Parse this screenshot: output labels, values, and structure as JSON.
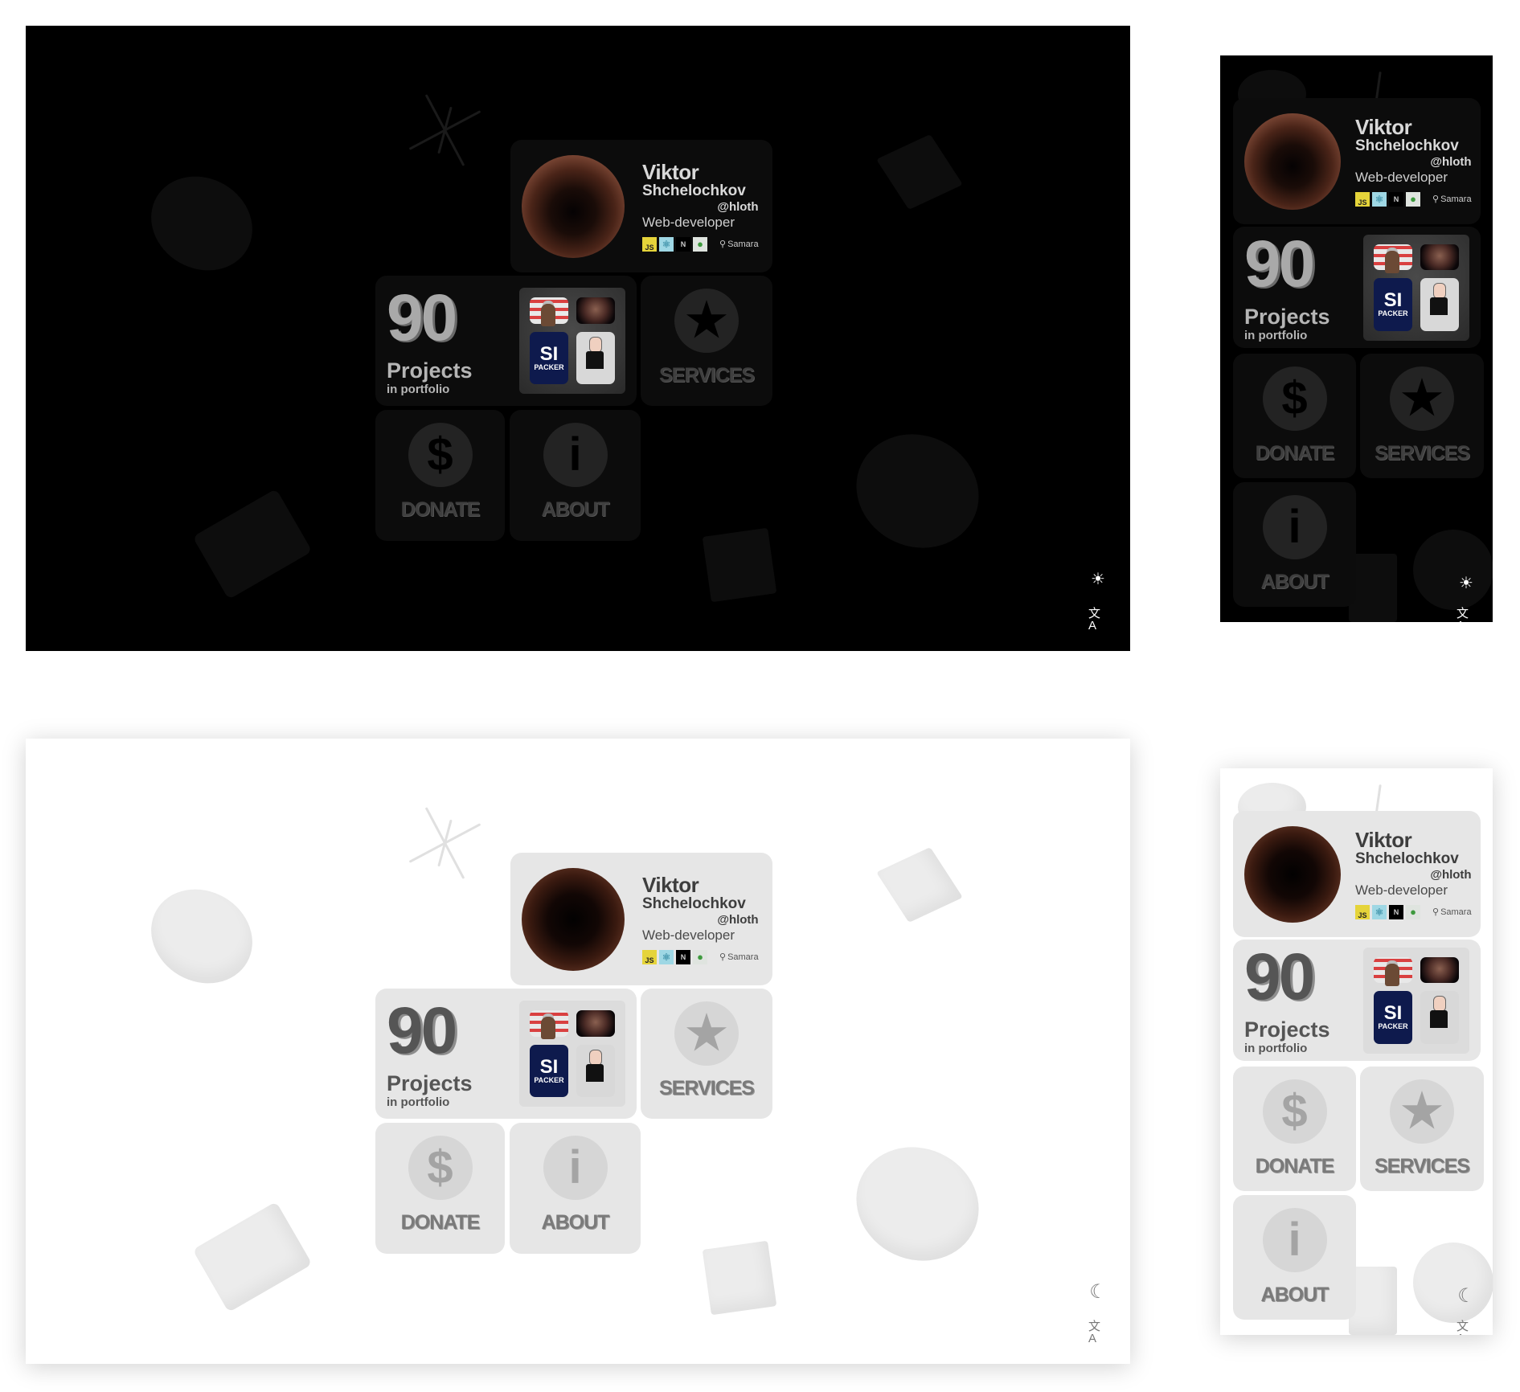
{
  "profile": {
    "first_name": "Viktor",
    "last_name": "Shchelochkov",
    "handle": "@hloth",
    "role": "Web-developer",
    "location": "Samara",
    "location_icon": "map-pin-icon",
    "tech_stack": [
      {
        "name": "javascript",
        "label": "JS"
      },
      {
        "name": "react",
        "label": "⚛"
      },
      {
        "name": "nextjs",
        "label": "N"
      },
      {
        "name": "mongodb",
        "label": "●"
      }
    ]
  },
  "projects": {
    "count": "90",
    "label": "Projects",
    "sublabel": "in portfolio",
    "thumbnails": [
      {
        "name": "cartoon-politician"
      },
      {
        "name": "dark-face-portrait"
      },
      {
        "name": "si-packer",
        "line1": "SI",
        "line2": "PACKER"
      },
      {
        "name": "pixel-character"
      }
    ]
  },
  "tiles": {
    "services": {
      "label": "SERVICES",
      "icon": "★"
    },
    "donate": {
      "label": "DONATE",
      "icon": "$"
    },
    "about": {
      "label": "ABOUT",
      "icon": "i"
    }
  },
  "controls": {
    "theme_dark_mode_icon": "☀",
    "theme_light_mode_icon": "☾",
    "language_icon": "文A"
  },
  "themes": [
    "dark",
    "light"
  ],
  "colors": {
    "dark_bg": "#000000",
    "dark_card": "#0c0c0c",
    "light_bg": "#ffffff",
    "light_card": "#e6e6e6",
    "js_badge": "#e5d43a",
    "react_badge": "#9ed7e4"
  }
}
